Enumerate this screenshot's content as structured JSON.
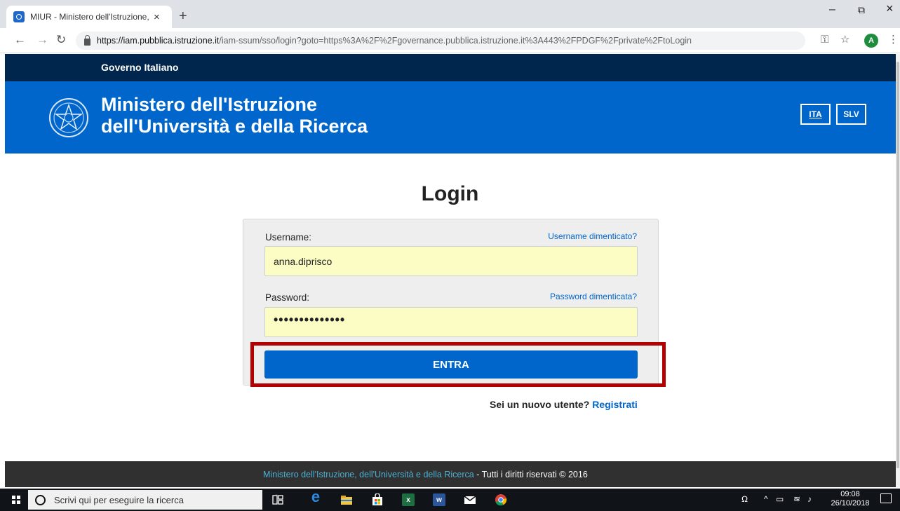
{
  "browser": {
    "tab_title": "MIUR - Ministero dell'Istruzione,",
    "tab_close": "×",
    "new_tab": "+",
    "win_minimize": "–",
    "win_maximize": "⧉",
    "win_close": "×",
    "back": "←",
    "forward": "→",
    "reload": "↻",
    "url_host": "https://iam.pubblica.istruzione.it",
    "url_path": "/iam-ssum/sso/login?goto=https%3A%2F%2Fgovernance.pubblica.istruzione.it%3A443%2FPDGF%2Fprivate%2FtoLogin",
    "key_icon": "⚿",
    "star_icon": "☆",
    "profile_initial": "A",
    "menu_icon": "⋮"
  },
  "site": {
    "gov_label": "Governo Italiano",
    "ministry_line1": "Ministero dell'Istruzione",
    "ministry_line2": "dell'Università e della Ricerca",
    "lang_ita": "ITA",
    "lang_slv": "SLV"
  },
  "login": {
    "title": "Login",
    "username_label": "Username:",
    "username_forgot": "Username dimenticato?",
    "username_value": "anna.diprisco",
    "password_label": "Password:",
    "password_forgot": "Password dimenticata?",
    "password_value": "••••••••••••••",
    "submit_label": "ENTRA",
    "register_prompt": "Sei un nuovo utente?",
    "register_link": "Registrati"
  },
  "footer": {
    "ministry_link": "Ministero dell'Istruzione, dell'Università e della Ricerca",
    "rights": " - Tutti i diritti riservati © 2016"
  },
  "taskbar": {
    "search_placeholder": "Scrivi qui per eseguire la ricerca",
    "time": "09:08",
    "date": "26/10/2018"
  },
  "colors": {
    "gov_bar": "#00264d",
    "header_blue": "#0066cc",
    "input_yellow": "#fbfdc4",
    "highlight_red": "#b30000",
    "footer_dark": "#303030",
    "footer_link": "#4faed0"
  }
}
